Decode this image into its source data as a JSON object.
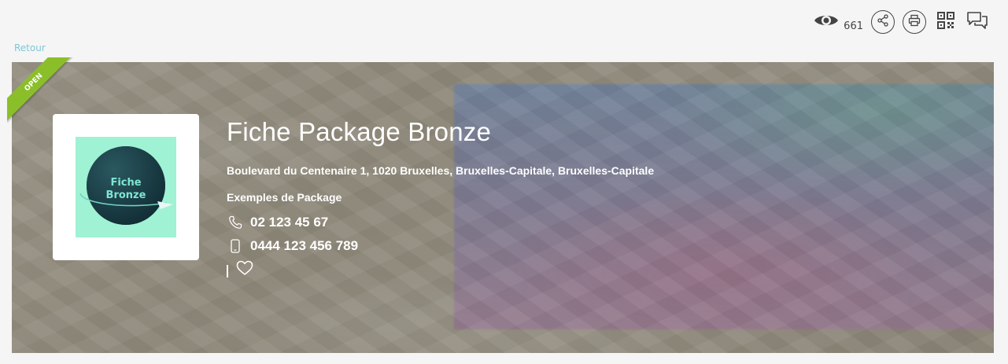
{
  "toolbar": {
    "view_count": "661",
    "icons": [
      "eye-icon",
      "share-icon",
      "print-icon",
      "qr-code-icon",
      "chat-icon"
    ]
  },
  "nav": {
    "back_label": "Retour"
  },
  "listing": {
    "status_ribbon": "OPEN",
    "title": "Fiche Package Bronze",
    "address": "Boulevard du Centenaire 1, 1020 Bruxelles, Bruxelles-Capitale, Bruxelles-Capitale",
    "category": "Exemples de Package",
    "phone": "02 123 45 67",
    "mobile": "0444 123 456 789",
    "logo_line1": "Fiche",
    "logo_line2": "Bronze"
  },
  "colors": {
    "ribbon": "#8bbf2a",
    "back_link": "#7ec7d6",
    "logo_bg": "#a0f2d4",
    "logo_circle": "#1c3f47"
  }
}
